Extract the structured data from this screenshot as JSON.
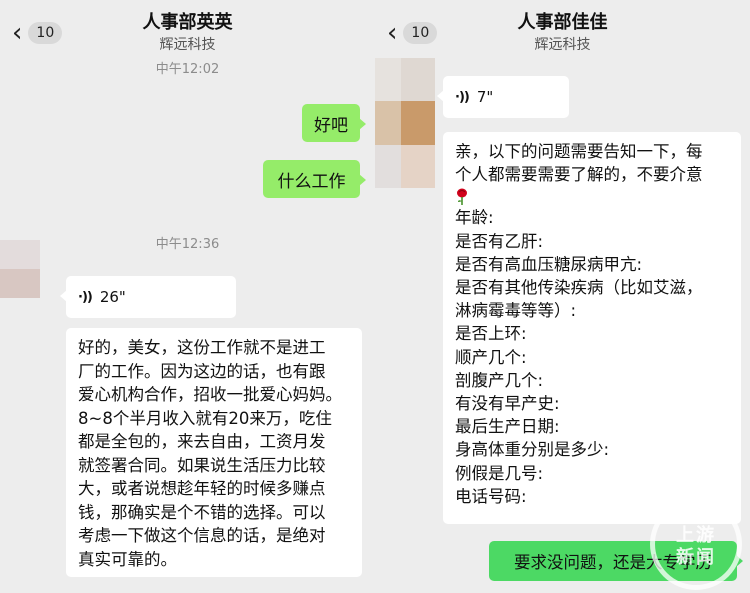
{
  "left_chat": {
    "back_count": "10",
    "contact_name": "人事部英英",
    "contact_company": "辉远科技",
    "time_1": "中午12:02",
    "msg_ok": "好吧",
    "msg_what_job": "什么工作",
    "time_2": "中午12:36",
    "voice_duration": "26\"",
    "long_message_lines": [
      "好的，美女，这份工作就不是进工",
      "厂的工作。因为这边的话，也有跟",
      "爱心机构合作，招收一批爱心妈妈。",
      "8~8个半月收入就有20来万，吃住",
      "都是全包的，来去自由，工资月发",
      "就签署合同。如果说生活压力比较",
      "大，或者说想趁年轻的时候多赚点",
      "钱，那确实是个不错的选择。可以",
      "考虑一下做这个信息的话，是绝对",
      "真实可靠的。"
    ]
  },
  "right_chat": {
    "back_count": "10",
    "contact_name": "人事部佳佳",
    "contact_company": "辉远科技",
    "voice_duration": "7\"",
    "questionnaire_lines": [
      "亲，以下的问题需要告知一下，每",
      "个人都需要需要了解的，不要介意",
      "",
      "年龄:",
      "是否有乙肝:",
      "是否有高血压糖尿病甲亢:",
      "是否有其他传染疾病（比如艾滋，",
      "淋病霉毒等等）:",
      "是否上环:",
      "顺产几个:",
      "剖腹产几个:",
      "有没有早产史:",
      "最后生产日期:",
      "身高体重分别是多少:",
      "例假是几号:",
      "电话号码:"
    ],
    "reply": "要求没问题，还是大专学历"
  },
  "watermark": "上游新闻",
  "colors": {
    "background": "#ededed",
    "sent_bubble": "#95ec69",
    "sent_bubble_bright": "#4cd964",
    "received_bubble": "#ffffff"
  },
  "icons": {
    "back": "chevron-left-icon",
    "voice": "voice-wave-icon",
    "rose": "rose-emoji-icon"
  }
}
